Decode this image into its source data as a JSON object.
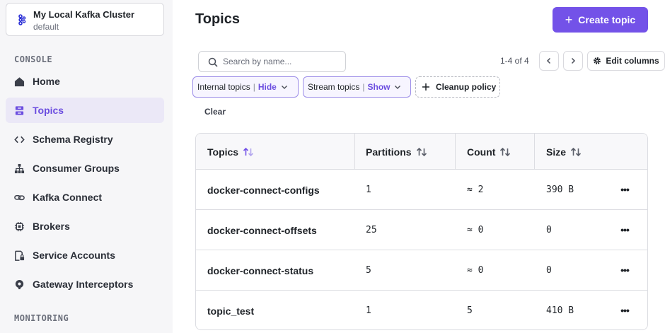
{
  "cluster": {
    "name": "My Local Kafka Cluster",
    "environment": "default"
  },
  "sidebar": {
    "console_title": "CONSOLE",
    "items": [
      {
        "label": "Home",
        "icon": "home-icon",
        "active": false
      },
      {
        "label": "Topics",
        "icon": "topics-icon",
        "active": true
      },
      {
        "label": "Schema Registry",
        "icon": "code-icon",
        "active": false
      },
      {
        "label": "Consumer Groups",
        "icon": "hierarchy-icon",
        "active": false
      },
      {
        "label": "Kafka Connect",
        "icon": "link-icon",
        "active": false
      },
      {
        "label": "Brokers",
        "icon": "chip-icon",
        "active": false
      },
      {
        "label": "Service Accounts",
        "icon": "account-lock-icon",
        "active": false
      },
      {
        "label": "Gateway Interceptors",
        "icon": "gateway-icon",
        "active": false
      }
    ],
    "monitoring_title": "MONITORING"
  },
  "header": {
    "title": "Topics",
    "create_button": "Create topic"
  },
  "search": {
    "placeholder": "Search by name...",
    "value": ""
  },
  "pagination": {
    "range": "1-4 of 4"
  },
  "toolbar": {
    "edit_columns": "Edit columns"
  },
  "filters": {
    "internal": {
      "label": "Internal topics",
      "value": "Hide"
    },
    "stream": {
      "label": "Stream topics",
      "value": "Show"
    },
    "cleanup": {
      "label": "Cleanup policy"
    },
    "clear": "Clear"
  },
  "table": {
    "columns": [
      "Topics",
      "Partitions",
      "Count",
      "Size"
    ],
    "rows": [
      {
        "name": "docker-connect-configs",
        "partitions": "1",
        "count": "≈ 2",
        "size": "390 B"
      },
      {
        "name": "docker-connect-offsets",
        "partitions": "25",
        "count": "≈ 0",
        "size": "0"
      },
      {
        "name": "docker-connect-status",
        "partitions": "5",
        "count": "≈ 0",
        "size": "0"
      },
      {
        "name": "topic_test",
        "partitions": "1",
        "count": "5",
        "size": "410 B"
      }
    ]
  },
  "colors": {
    "accent": "#7352e8",
    "active_bg": "#ebe8f7",
    "sidebar_bg": "#f6f6f8"
  }
}
